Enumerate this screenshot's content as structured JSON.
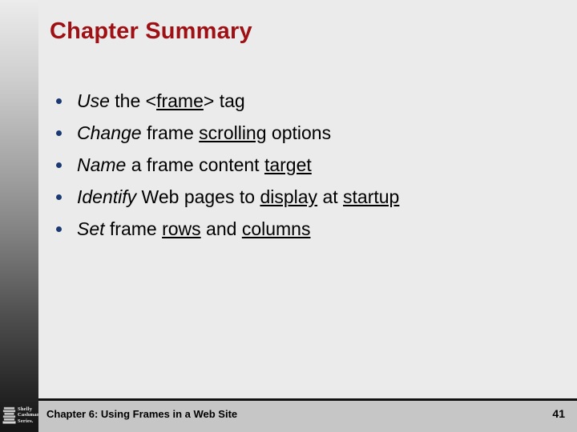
{
  "slide": {
    "title": "Chapter Summary",
    "bullets": [
      {
        "id": "bullet-use-frame-tag",
        "fragments": [
          {
            "text": "Use",
            "style": "italic"
          },
          {
            "text": " the <",
            "style": "plain"
          },
          {
            "text": "frame",
            "style": "underline"
          },
          {
            "text": "> tag",
            "style": "plain"
          }
        ]
      },
      {
        "id": "bullet-change-scrolling",
        "fragments": [
          {
            "text": "Change",
            "style": "italic"
          },
          {
            "text": " frame ",
            "style": "plain"
          },
          {
            "text": "scrolling",
            "style": "underline"
          },
          {
            "text": " options",
            "style": "plain"
          }
        ]
      },
      {
        "id": "bullet-name-target",
        "fragments": [
          {
            "text": "Name",
            "style": "italic"
          },
          {
            "text": " a frame content ",
            "style": "plain"
          },
          {
            "text": "target",
            "style": "underline"
          }
        ]
      },
      {
        "id": "bullet-identify-display-startup",
        "fragments": [
          {
            "text": "Identify",
            "style": "italic"
          },
          {
            "text": " Web pages to ",
            "style": "plain"
          },
          {
            "text": "display",
            "style": "underline"
          },
          {
            "text": " at ",
            "style": "plain"
          },
          {
            "text": "startup",
            "style": "underline"
          }
        ]
      },
      {
        "id": "bullet-set-rows-columns",
        "fragments": [
          {
            "text": "Set",
            "style": "italic"
          },
          {
            "text": " frame ",
            "style": "plain"
          },
          {
            "text": "rows",
            "style": "underline"
          },
          {
            "text": " and ",
            "style": "plain"
          },
          {
            "text": "columns",
            "style": "underline"
          }
        ]
      }
    ]
  },
  "footer": {
    "text": "Chapter 6: Using Frames in a Web Site",
    "page_number": "41"
  },
  "logo": {
    "icon": "stacked-books-icon",
    "line1": "Shelly",
    "line2": "Cashman",
    "line3": "Series."
  },
  "colors": {
    "title": "#9e1013",
    "bullet_dot": "#1b3a72",
    "background": "#ebebeb",
    "footer_bar": "#c6c6c6",
    "footer_rule": "#111111"
  }
}
